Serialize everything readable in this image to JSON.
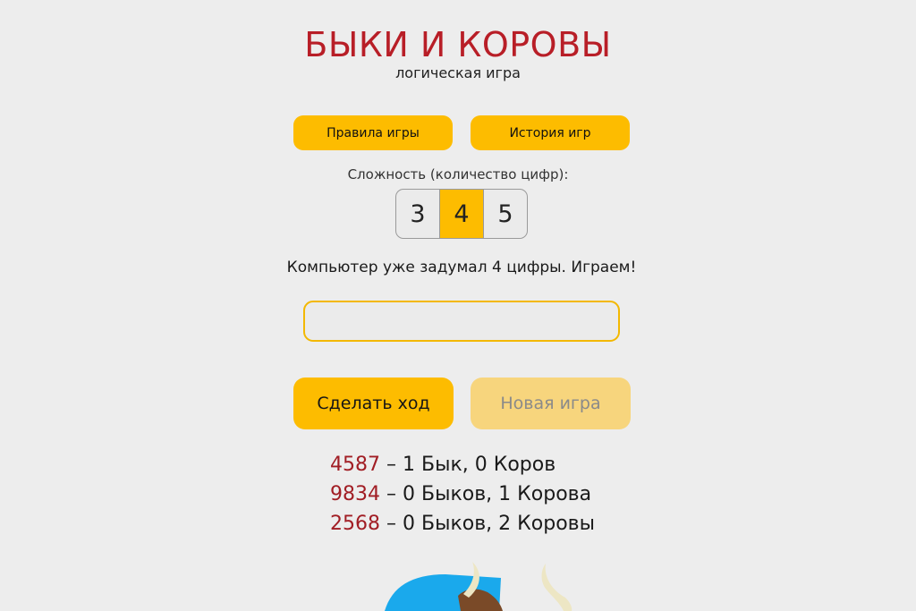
{
  "header": {
    "title": "БЫКИ И КОРОВЫ",
    "subtitle": "логическая игра"
  },
  "top_buttons": {
    "rules": "Правила игры",
    "history": "История игр"
  },
  "difficulty": {
    "label": "Сложность (количество цифр):",
    "options": [
      "3",
      "4",
      "5"
    ],
    "selected": "4"
  },
  "status_text": "Компьютер уже задумал 4 цифры. Играем!",
  "guess_input": {
    "value": "",
    "placeholder": ""
  },
  "actions": {
    "make_move": "Сделать ход",
    "new_game": "Новая игра"
  },
  "moves": [
    {
      "guess": "4587",
      "separator": "–",
      "result": "1 Бык, 0 Коров"
    },
    {
      "guess": "9834",
      "separator": "–",
      "result": "0 Быков, 1 Корова"
    },
    {
      "guess": "2568",
      "separator": "–",
      "result": "0 Быков, 2 Коровы"
    }
  ],
  "colors": {
    "accent": "#fdbc00",
    "title_red": "#b81e27",
    "guess_red": "#a11d24",
    "background": "#ededed",
    "disabled_button": "#f7d57d"
  },
  "illustration": {
    "icon": "bull-mascot-icon"
  }
}
